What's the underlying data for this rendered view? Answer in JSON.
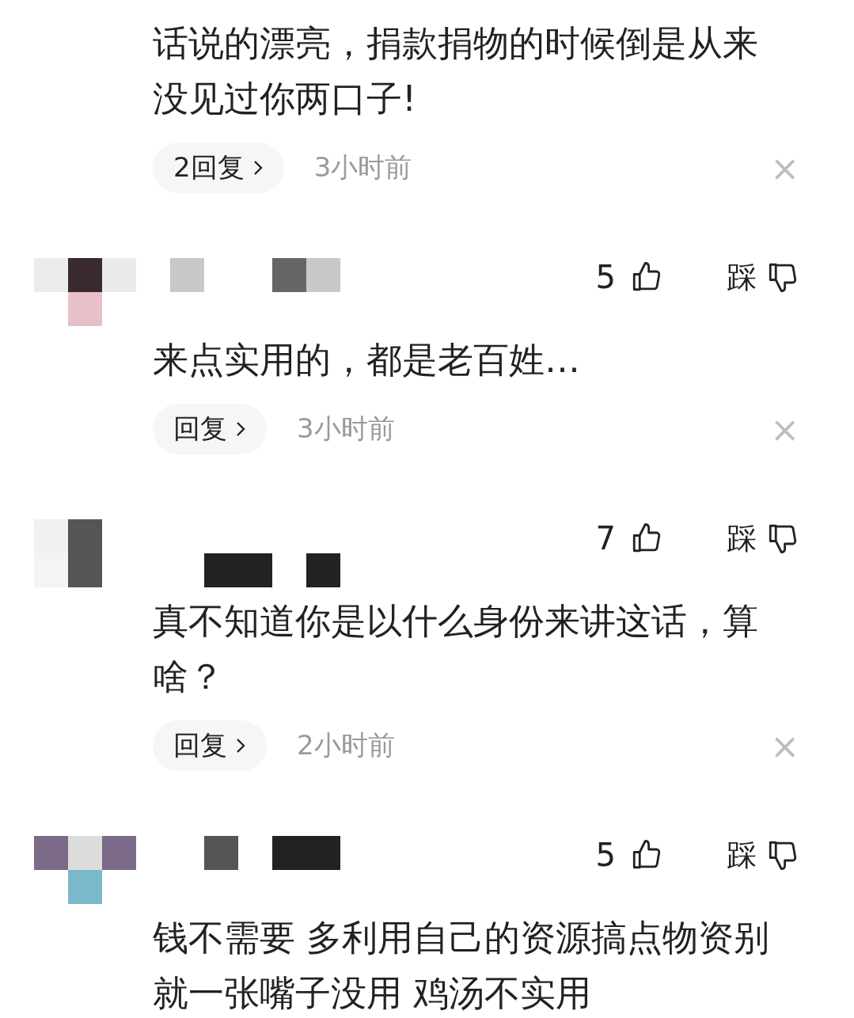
{
  "comments": [
    {
      "text": "话说的漂亮，捐款捐物的时候倒是从来没见过你两口子!",
      "reply_label": "2回复",
      "time": "3小时前",
      "close": "×"
    },
    {
      "likes": "5",
      "dislike_label": "踩",
      "text": "来点实用的，都是老百姓…",
      "reply_label": "回复",
      "time": "3小时前",
      "close": "×"
    },
    {
      "likes": "7",
      "dislike_label": "踩",
      "text": "真不知道你是以什么身份来讲这话，算啥？",
      "reply_label": "回复",
      "time": "2小时前",
      "close": "×"
    },
    {
      "likes": "5",
      "dislike_label": "踩",
      "text": "钱不需要 多利用自己的资源搞点物资别就一张嘴子没用 鸡汤不实用"
    }
  ]
}
